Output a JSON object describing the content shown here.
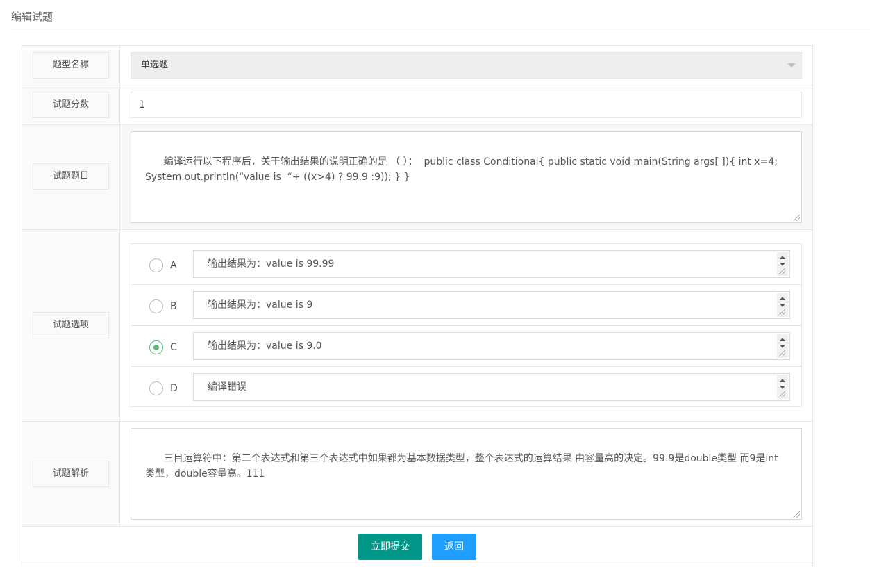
{
  "page": {
    "title": "编辑试题"
  },
  "form": {
    "type": {
      "label": "题型名称",
      "value": "单选题"
    },
    "score": {
      "label": "试题分数",
      "value": "1"
    },
    "question": {
      "label": "试题题目",
      "value": "编译运行以下程序后，关于输出结果的说明正确的是 （ ）：  public class Conditional{ public static void main(String args[ ]){ int x=4;\nSystem.out.println(“value is  “+ ((x>4) ? 99.9 :9)); } }"
    },
    "options": {
      "label": "试题选项",
      "selected": "C",
      "items": [
        {
          "letter": "A",
          "text": "输出结果为：value is 99.99",
          "checked": false
        },
        {
          "letter": "B",
          "text": "输出结果为：value is 9",
          "checked": false
        },
        {
          "letter": "C",
          "text": "输出结果为：value is 9.0",
          "checked": true
        },
        {
          "letter": "D",
          "text": "编译错误",
          "checked": false
        }
      ]
    },
    "analysis": {
      "label": "试题解析",
      "value": "三目运算符中：第二个表达式和第三个表达式中如果都为基本数据类型，整个表达式的运算结果 由容量高的决定。99.9是double类型 而9是int类型，double容量高。111"
    }
  },
  "actions": {
    "submit_label": "立即提交",
    "back_label": "返回"
  },
  "colors": {
    "submit": "#009688",
    "back": "#1e9fff",
    "radio_checked": "#5fb878"
  }
}
